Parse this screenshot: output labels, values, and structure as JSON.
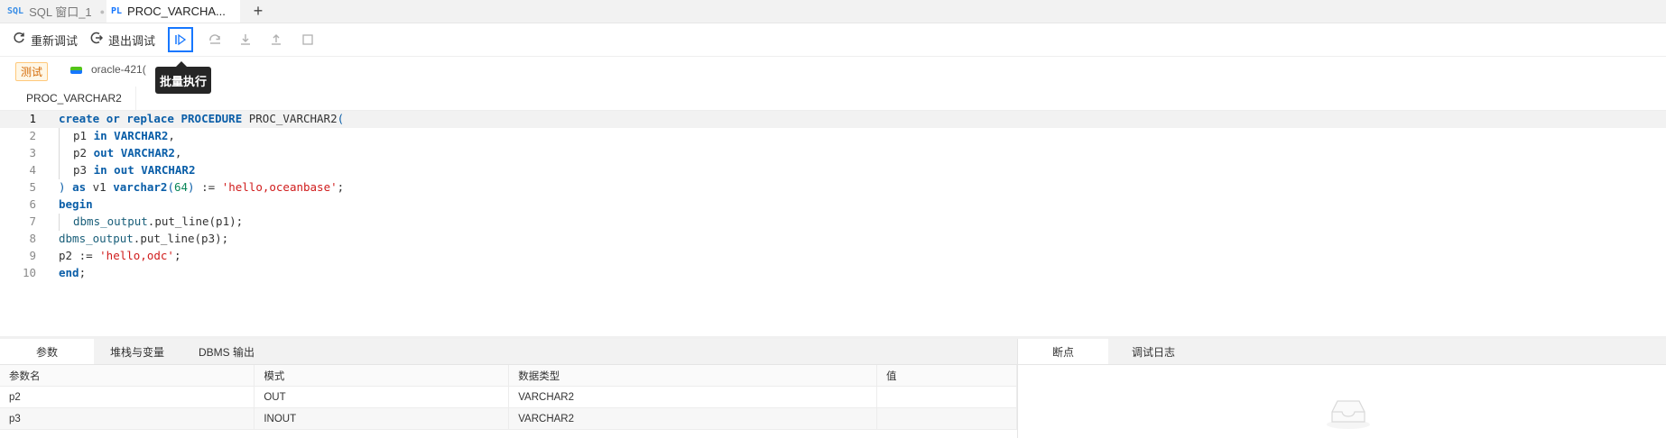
{
  "tabs": [
    {
      "icon": "SQL",
      "label": "SQL 窗口_1",
      "dot": "●"
    },
    {
      "icon": "PL",
      "label": "PROC_VARCHA..."
    }
  ],
  "add_tab": "+",
  "toolbar": {
    "restart_label": "重新调试",
    "exit_label": "退出调试"
  },
  "tooltip": "批量执行",
  "env": {
    "tag": "测试",
    "datasource": "oracle-421("
  },
  "object_tab": "PROC_VARCHAR2",
  "code_lines": [
    "1",
    "2",
    "3",
    "4",
    "5",
    "6",
    "7",
    "8",
    "9",
    "10"
  ],
  "code": {
    "l1": [
      "create",
      " ",
      "or",
      " ",
      "replace",
      " ",
      "PROCEDURE",
      " PROC_VARCHAR2",
      "("
    ],
    "l2": [
      "p1 ",
      "in",
      " ",
      "VARCHAR2",
      ","
    ],
    "l3": [
      "p2 ",
      "out",
      " ",
      "VARCHAR2",
      ","
    ],
    "l4": [
      "p3 ",
      "in",
      " ",
      "out",
      " ",
      "VARCHAR2"
    ],
    "l5": [
      ")",
      " ",
      "as",
      " v1 ",
      "varchar2",
      "(",
      "64",
      ")",
      " := ",
      "'hello,oceanbase'",
      ";"
    ],
    "l6": [
      "begin"
    ],
    "l7": [
      "dbms_output",
      ".put_line(p1);"
    ],
    "l8": [
      "dbms_output",
      ".put_line(p3);"
    ],
    "l9": [
      "p2 := ",
      "'hello,odc'",
      ";"
    ],
    "l10": [
      "end",
      ";"
    ]
  },
  "bottom_tabs": [
    "参数",
    "堆栈与变量",
    "DBMS 输出"
  ],
  "right_tabs": [
    "断点",
    "调试日志"
  ],
  "params": {
    "headers": [
      "参数名",
      "模式",
      "数据类型",
      "值"
    ],
    "rows": [
      [
        "p2",
        "OUT",
        "VARCHAR2",
        ""
      ],
      [
        "p3",
        "INOUT",
        "VARCHAR2",
        ""
      ]
    ]
  }
}
